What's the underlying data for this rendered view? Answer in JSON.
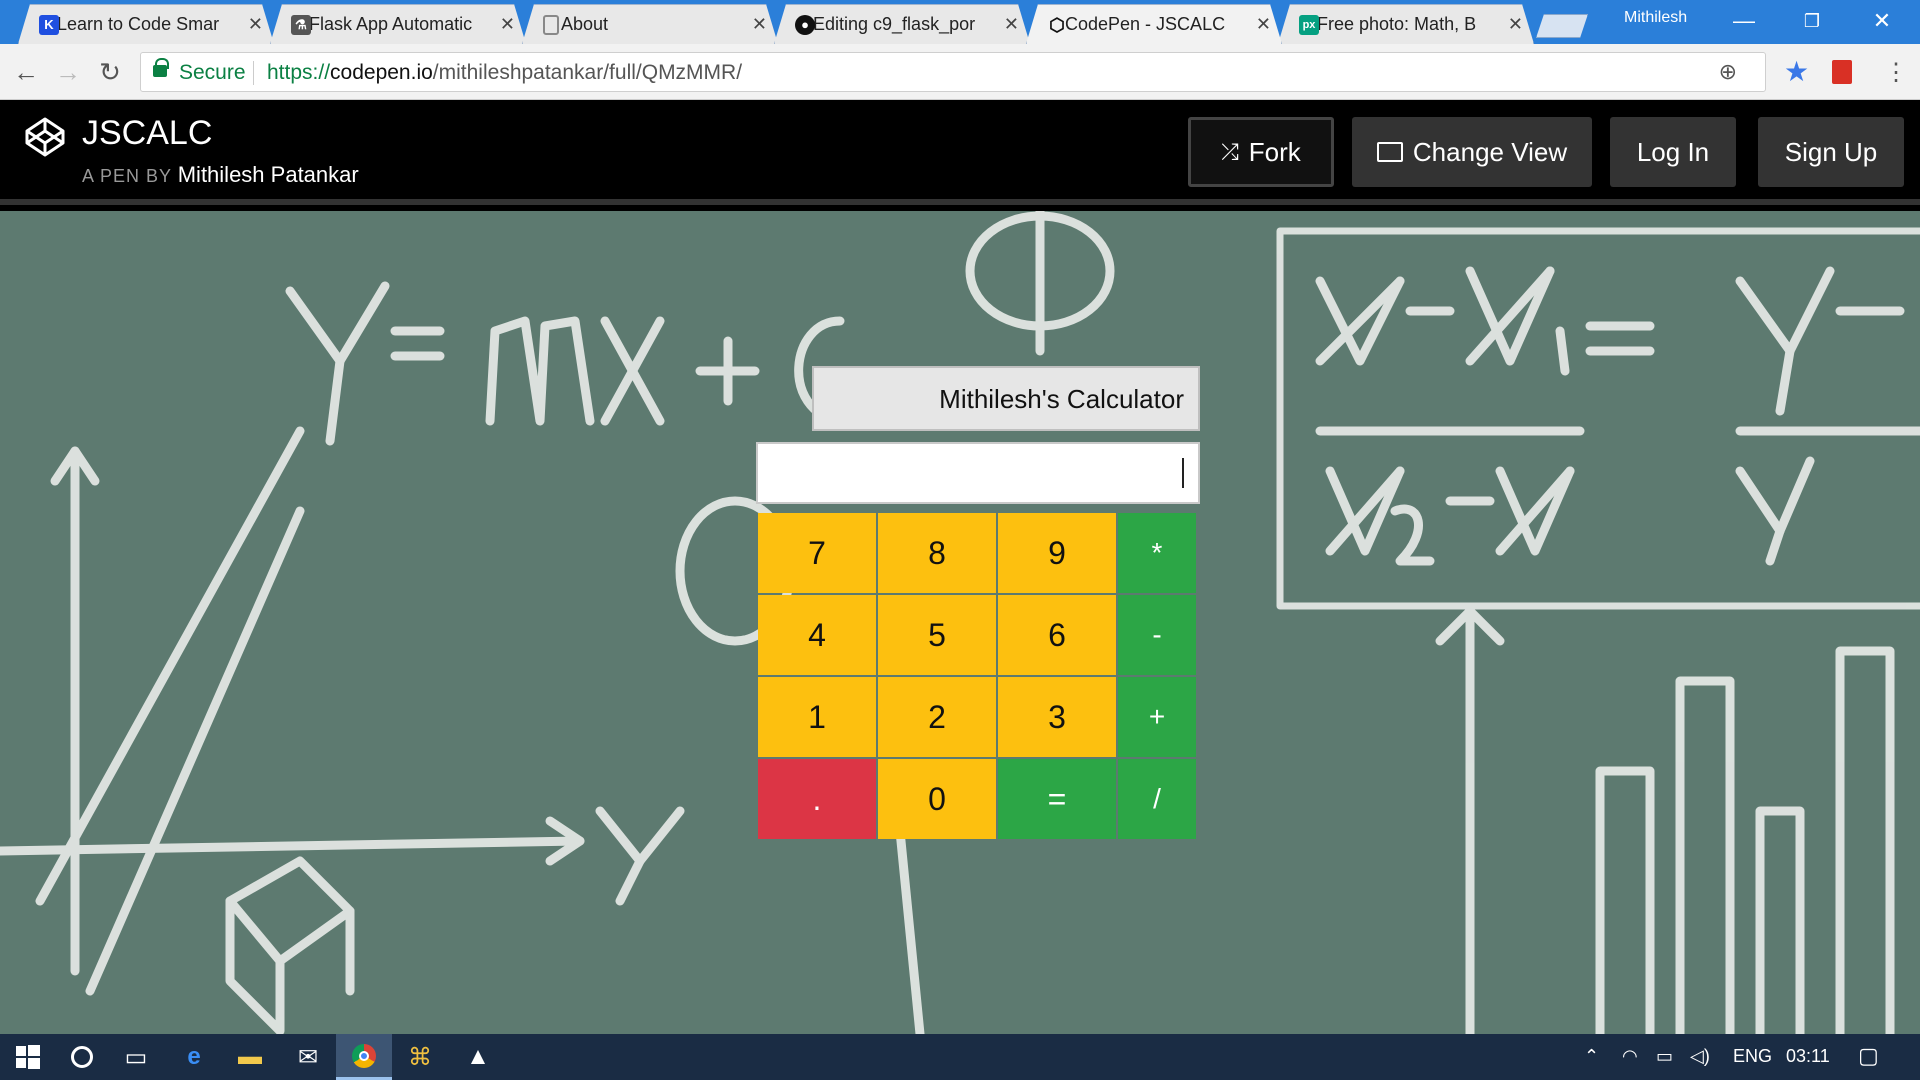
{
  "browser": {
    "tabs": [
      {
        "title": "Learn to Code Smar",
        "icon": "codecademy-icon",
        "color": "#1f4fe0"
      },
      {
        "title": "Flask App Automatic",
        "icon": "flask-icon",
        "color": "#444444"
      },
      {
        "title": "About",
        "icon": "page-icon",
        "color": "#888888"
      },
      {
        "title": "Editing c9_flask_por",
        "icon": "github-icon",
        "color": "#111111"
      },
      {
        "title": "CodePen - JSCALC",
        "icon": "codepen-icon",
        "color": "#111111",
        "active": true
      },
      {
        "title": "Free photo: Math, B",
        "icon": "pexels-icon",
        "color": "#05a081"
      }
    ],
    "profile_name": "Mithilesh",
    "secure_label": "Secure",
    "url_scheme": "https://",
    "url_host": "codepen.io",
    "url_path": "/mithileshpatankar/full/QMzMMR/"
  },
  "codepen": {
    "title": "JSCALC",
    "by_label": "A PEN BY",
    "author": "Mithilesh Patankar",
    "buttons": {
      "fork": "Fork",
      "change_view": "Change View",
      "login": "Log In",
      "signup": "Sign Up"
    }
  },
  "calculator": {
    "title": "Mithilesh's Calculator",
    "display_value": "",
    "keys": [
      "7",
      "8",
      "9",
      "*",
      "4",
      "5",
      "6",
      "-",
      "1",
      "2",
      "3",
      "+",
      ".",
      "0",
      "=",
      "/"
    ]
  },
  "taskbar": {
    "language": "ENG",
    "time": "03:11"
  },
  "colors": {
    "chrome_blue": "#2b7fd9",
    "board": "#5d7a70",
    "key_number": "#fdc00f",
    "key_operator": "#2ca646",
    "key_dot": "#dc3545",
    "taskbar": "#1a2c44"
  }
}
